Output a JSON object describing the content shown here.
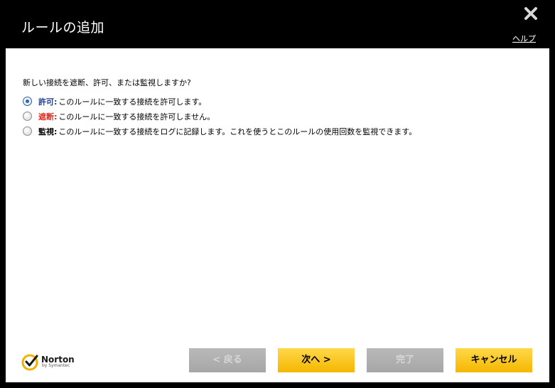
{
  "window": {
    "title": "ルールの追加",
    "help_link": "ヘルプ"
  },
  "content": {
    "question": "新しい接続を遮断、許可、または監視しますか?",
    "options": [
      {
        "label": "許可:",
        "description": "このルールに一致する接続を許可します。",
        "checked": true,
        "label_color": "#1c3f96"
      },
      {
        "label": "遮断:",
        "description": "このルールに一致する接続を許可しません。",
        "checked": false,
        "label_color": "#d52b1e"
      },
      {
        "label": "監視:",
        "description": "このルールに一致する接続をログに記録します。これを使うとこのルールの使用回数を監視できます。",
        "checked": false,
        "label_color": "#000000"
      }
    ]
  },
  "footer": {
    "logo": {
      "name": "Norton",
      "sub": "by Symantec",
      "icon": "norton-checkmark-icon"
    },
    "buttons": {
      "back": "< 戻る",
      "next": "次へ >",
      "finish": "完了",
      "cancel": "キャンセル"
    }
  },
  "colors": {
    "accent": "#f5b700",
    "disabled": "#a6a6a6",
    "background": "#000000"
  }
}
